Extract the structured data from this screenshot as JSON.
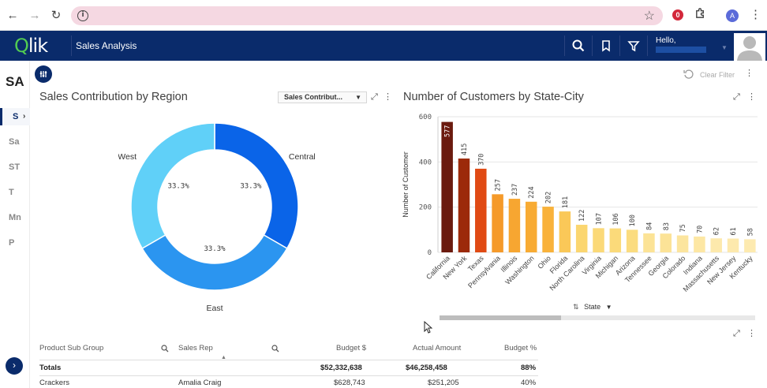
{
  "header": {
    "logo": "Qlik",
    "app_title": "Sales Analysis",
    "hello": "Hello,"
  },
  "sidebar": {
    "title": "SA",
    "items": [
      "S",
      "Sa",
      "ST",
      "T",
      "Mn",
      "P"
    ]
  },
  "toolbar": {
    "clear_filter": "Clear Filter"
  },
  "donut": {
    "title": "Sales Contribution by Region",
    "dropdown_value": "Sales Contribut...",
    "labels": {
      "central": "Central",
      "east": "East",
      "west": "West"
    },
    "pct": {
      "central": "33.3%",
      "east": "33.3%",
      "west": "33.3%"
    },
    "colors": {
      "central": "#0a64e8",
      "east": "#2b95f0",
      "west": "#60d0f8"
    }
  },
  "bar": {
    "title": "Number of Customers by State-City",
    "sort_label": "State"
  },
  "chart_data": [
    {
      "type": "pie",
      "title": "Sales Contribution by Region",
      "categories": [
        "Central",
        "East",
        "West"
      ],
      "values": [
        33.3,
        33.3,
        33.3
      ]
    },
    {
      "type": "bar",
      "title": "Number of Customers by State-City",
      "ylabel": "Number of Customer",
      "xlabel": "",
      "ylim": [
        0,
        600
      ],
      "yticks": [
        0,
        200,
        400,
        600
      ],
      "categories": [
        "California",
        "New York",
        "Texas",
        "Pennsylvania",
        "Illinois",
        "Washington",
        "Ohio",
        "Florida",
        "North Carolina",
        "Virginia",
        "Michigan",
        "Arizona",
        "Tennessee",
        "Georgia",
        "Colorado",
        "Indiana",
        "Massachusetts",
        "New Jersey",
        "Kentucky"
      ],
      "values": [
        577,
        415,
        370,
        257,
        237,
        224,
        202,
        181,
        122,
        107,
        106,
        100,
        84,
        83,
        75,
        70,
        62,
        61,
        58
      ],
      "colors": [
        "#6b1a0e",
        "#9c2a0a",
        "#e04a14",
        "#f59a2a",
        "#f7a631",
        "#f8ab33",
        "#f9b23a",
        "#fac858",
        "#fbd670",
        "#fbd978",
        "#fbda7a",
        "#fbdc7f",
        "#fce396",
        "#fce397",
        "#fce59e",
        "#fde7a4",
        "#fde9ac",
        "#fde9ad",
        "#fdeab0"
      ]
    }
  ],
  "table": {
    "headers": {
      "product_sub_group": "Product Sub Group",
      "sales_rep": "Sales Rep",
      "budget": "Budget $",
      "actual": "Actual Amount",
      "budget_pct": "Budget %"
    },
    "totals": {
      "label": "Totals",
      "budget": "$52,332,638",
      "actual": "$46,258,458",
      "budget_pct": "88%"
    },
    "rows": [
      {
        "product_sub_group": "Crackers",
        "sales_rep": "Amalia Craig",
        "budget": "$628,743",
        "actual": "$251,205",
        "budget_pct": "40%"
      }
    ]
  }
}
